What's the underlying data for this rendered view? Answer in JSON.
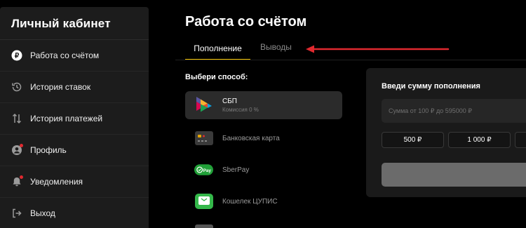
{
  "sidebar": {
    "title": "Личный кабинет",
    "items": [
      {
        "label": "Работа со счётом",
        "icon": "ruble-coin-icon"
      },
      {
        "label": "История ставок",
        "icon": "history-icon"
      },
      {
        "label": "История платежей",
        "icon": "transfer-arrows-icon"
      },
      {
        "label": "Профиль",
        "icon": "user-icon"
      },
      {
        "label": "Уведомления",
        "icon": "bell-icon"
      },
      {
        "label": "Выход",
        "icon": "logout-icon"
      }
    ]
  },
  "page": {
    "title": "Работа со счётом"
  },
  "tabs": {
    "active": "Пополнение",
    "inactive": "Выводы"
  },
  "methods": {
    "label": "Выбери способ:",
    "items": [
      {
        "name": "СБП",
        "sub": "Комиссия 0 %",
        "icon": "sbp-logo-icon",
        "selected": true
      },
      {
        "name": "Банковская карта",
        "icon": "bank-card-icon"
      },
      {
        "name": "SberPay",
        "icon": "sberpay-logo-icon"
      },
      {
        "name": "Кошелек ЦУПИС",
        "icon": "wallet-icon"
      }
    ]
  },
  "amount": {
    "title": "Введи сумму пополнения",
    "placeholder": "Сумма от 100 ₽ до 595000 ₽",
    "chips": [
      "500 ₽",
      "1 000 ₽"
    ]
  },
  "colors": {
    "accent": "#f5c400",
    "annotation_arrow": "#e0292f",
    "notification_dot": "#e0292f"
  }
}
